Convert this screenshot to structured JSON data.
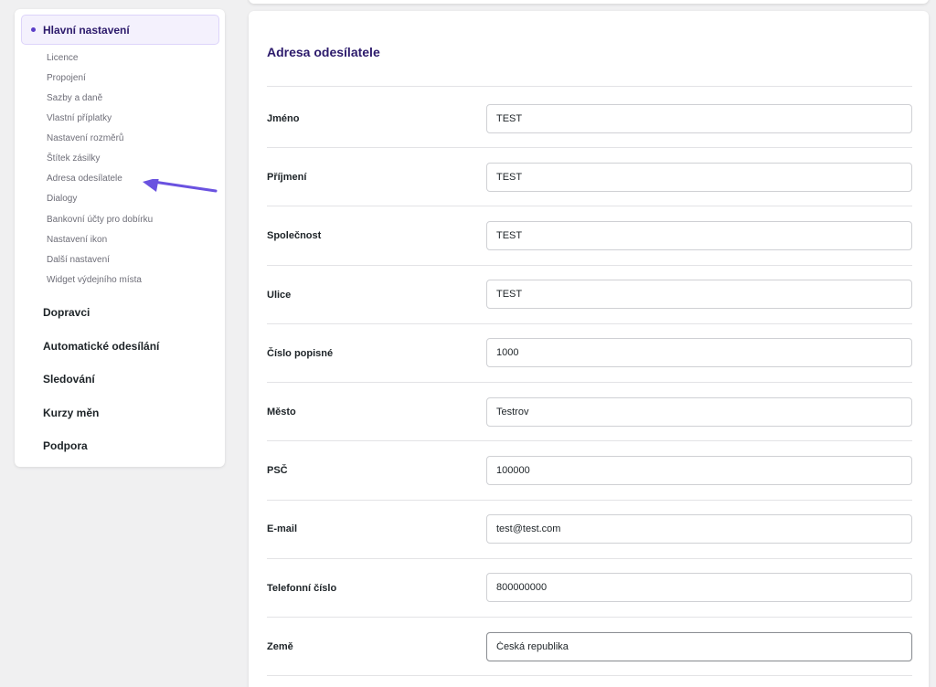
{
  "sidebar": {
    "main_item": "Hlavní nastavení",
    "sub_items": [
      "Licence",
      "Propojení",
      "Sazby a daně",
      "Vlastní příplatky",
      "Nastavení rozměrů",
      "Štítek zásilky",
      "Adresa odesílatele",
      "Dialogy",
      "Bankovní účty pro dobírku",
      "Nastavení ikon",
      "Další nastavení",
      "Widget výdejního místa"
    ],
    "sections": [
      "Dopravci",
      "Automatické odesílání",
      "Sledování",
      "Kurzy měn",
      "Podpora"
    ]
  },
  "form": {
    "title": "Adresa odesílatele",
    "fields": [
      {
        "label": "Jméno",
        "value": "TEST"
      },
      {
        "label": "Příjmení",
        "value": "TEST"
      },
      {
        "label": "Společnost",
        "value": "TEST"
      },
      {
        "label": "Ulice",
        "value": "TEST"
      },
      {
        "label": "Číslo popisné",
        "value": "1000"
      },
      {
        "label": "Město",
        "value": "Testrov"
      },
      {
        "label": "PSČ",
        "value": "100000"
      },
      {
        "label": "E-mail",
        "value": "test@test.com"
      },
      {
        "label": "Telefonní číslo",
        "value": "800000000"
      },
      {
        "label": "Země",
        "value": "Česká republika"
      }
    ]
  },
  "colors": {
    "accent": "#5b3ec8",
    "arrow": "#6a52e0",
    "title": "#2c1a6b"
  },
  "icons": {
    "active_marker": "bullet-dot-icon",
    "annotation": "arrow-left-icon"
  }
}
